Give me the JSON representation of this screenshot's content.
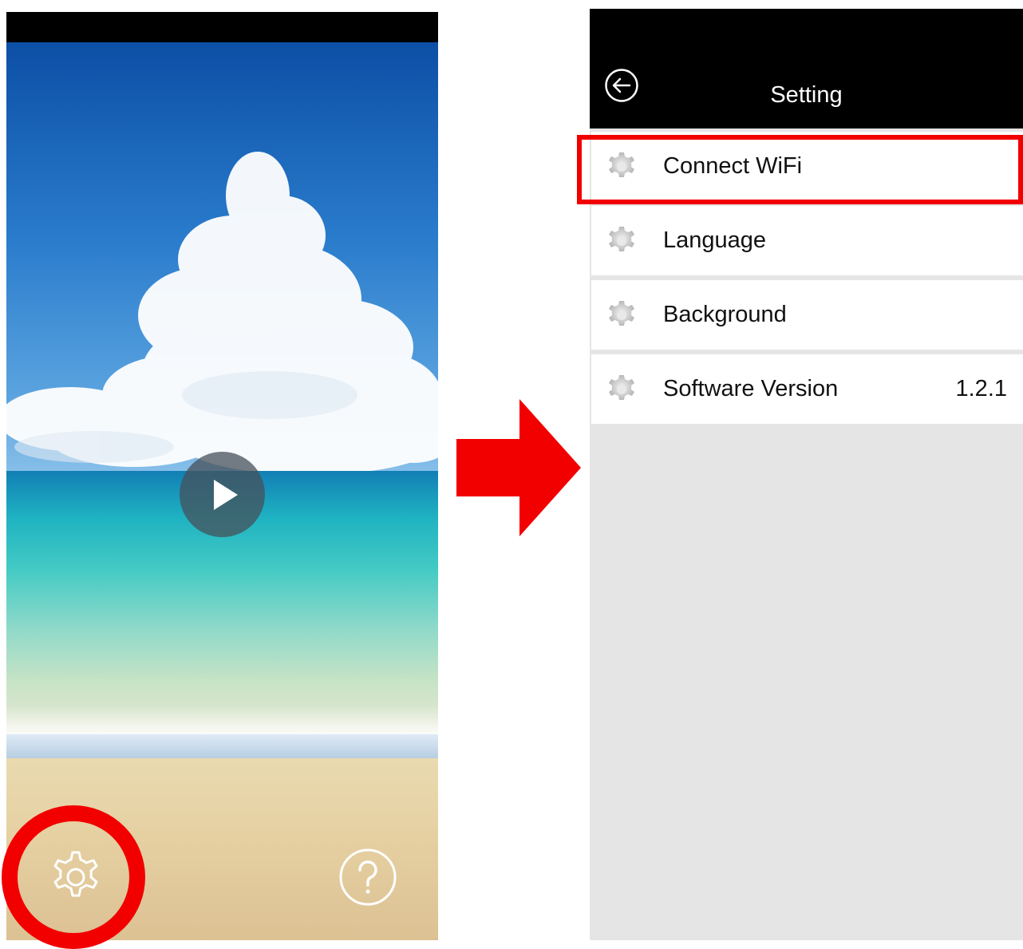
{
  "left_screen": {
    "play_icon": "play-icon",
    "settings_icon": "gear-icon",
    "help_icon": "question-icon"
  },
  "arrow": {
    "color": "#f20000"
  },
  "right_screen": {
    "title": "Setting",
    "back_icon": "back-arrow-icon",
    "menu": [
      {
        "label": "Connect WiFi",
        "value": ""
      },
      {
        "label": "Language",
        "value": ""
      },
      {
        "label": "Background",
        "value": ""
      },
      {
        "label": "Software Version",
        "value": "1.2.1"
      }
    ]
  },
  "highlight_color": "#f20000"
}
